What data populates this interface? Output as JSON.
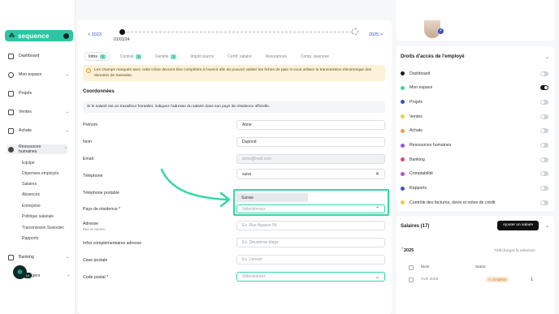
{
  "brand": {
    "name": "sequence",
    "accent": "#2ec4a4",
    "dark": "#0d2b28"
  },
  "sidebar": {
    "items": [
      {
        "label": "Dashboard",
        "icon": "home-icon",
        "chev": ""
      },
      {
        "label": "Mon espace",
        "icon": "user-icon",
        "chev": "⌄"
      },
      {
        "label": "Projets",
        "icon": "check-square-icon",
        "chev": ""
      },
      {
        "label": "Ventes",
        "icon": "receipt-icon",
        "chev": "⌄"
      },
      {
        "label": "Achats",
        "icon": "bag-icon",
        "chev": "⌄"
      },
      {
        "label": "Ressources humaines",
        "icon": "people-icon",
        "chev": "⌃"
      },
      {
        "label": "Banking",
        "icon": "bank-icon",
        "chev": "⌄"
      },
      {
        "label": "...ngers",
        "icon": "globe-icon",
        "chev": "›"
      }
    ],
    "sub_items": [
      "Equipe",
      "Dépenses employés",
      "Salaires",
      "Absences",
      "Entreprise",
      "Politique salariale",
      "Transmission Swissdec",
      "Rapports"
    ],
    "help_count": "14"
  },
  "timeline": {
    "prev": "< 2023",
    "next": "2025 >",
    "date": "01/01/24"
  },
  "tabs": [
    {
      "label": "Infos",
      "badge": "3",
      "active": true
    },
    {
      "label": "Contrat",
      "badge": "1",
      "active": false
    },
    {
      "label": "Famille",
      "badge": "1",
      "active": false
    },
    {
      "label": "Impôt source",
      "badge": "",
      "active": false
    },
    {
      "label": "Certif. salaire",
      "badge": "",
      "active": false
    },
    {
      "label": "Assurances",
      "badge": "",
      "active": false
    },
    {
      "label": "Comp. avancée",
      "badge": "",
      "active": false
    }
  ],
  "warning": "Les champs marqués avec cette icône devront être complétés à l'avenir afin de pouvoir valider les fiches de paie si vous utilisez la transmission électronique des données de Swissdec.",
  "section": "Coordonnées",
  "note": "Si le salarié est un travailleur frontalier, indiquez l'adresse du salarié dans son pays de résidence officielle.",
  "form": {
    "prenom_label": "Prénom",
    "prenom_value": "Anne",
    "nom_label": "Nom",
    "nom_value": "Dupond",
    "email_label": "Email",
    "email_value": "anne@mail.com",
    "telephone_label": "Téléphone",
    "search_value": "suiss",
    "portable_label": "Téléphone portable",
    "dropdown_option": "Suisse",
    "pays_label": "Pays de résidence *",
    "pays_placeholder": "Sélectionnez",
    "adresse_label": "Adresse",
    "adresse_sub": "Rue et numéro",
    "adresse_placeholder": "Ex. Rue Agasse 54",
    "infos_label": "Infos complémentaires adresse",
    "infos_placeholder": "Ex. Deuxième étage",
    "case_label": "Case postale",
    "case_placeholder": "Ex. Lenvior",
    "postal_label": "Code postal *",
    "postal_placeholder": "Sélectionnez"
  },
  "rights": {
    "title": "Droits d'accès de l'employé",
    "rows": [
      {
        "label": "Dashboard",
        "color": "#1b1b1b",
        "on": false
      },
      {
        "label": "Mon espace",
        "color": "#35d6a8",
        "on": true
      },
      {
        "label": "Projets",
        "color": "#3b52c5",
        "on": false
      },
      {
        "label": "Ventes",
        "color": "#f2c94c",
        "on": false
      },
      {
        "label": "Achats",
        "color": "#f2994a",
        "on": false
      },
      {
        "label": "Ressources humaines",
        "color": "#9b51e0",
        "on": false
      },
      {
        "label": "Banking",
        "color": "#e0457b",
        "on": false
      },
      {
        "label": "Comptabilité",
        "color": "#b84ed6",
        "on": false
      },
      {
        "label": "Rapports",
        "color": "#3b52c5",
        "on": false
      },
      {
        "label": "Contrôle des factures, devis et notes de crédit",
        "color": "#f2c94c",
        "on": false
      }
    ]
  },
  "salaries": {
    "title": "Salaires (17)",
    "add_button": "Ajouter un salaire",
    "year": "2025",
    "download": "Télécharger la sélection",
    "col_month": "Mois",
    "col_status": "Statut",
    "rows": [
      {
        "month": "Avril 2025",
        "status": "À compléter"
      }
    ]
  }
}
